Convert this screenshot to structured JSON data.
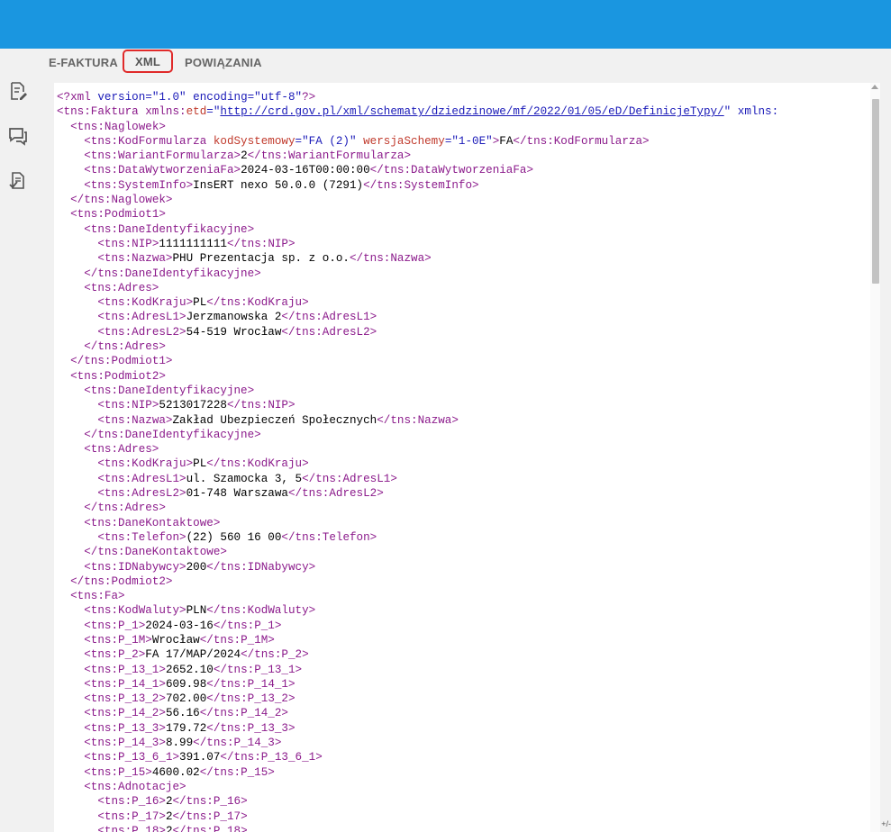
{
  "tabs": [
    {
      "label": "E-FAKTURA",
      "active": false
    },
    {
      "label": "XML",
      "active": true
    },
    {
      "label": "POWIĄZANIA",
      "active": false
    }
  ],
  "sidebar": {
    "icons": [
      "edit-document-icon",
      "chat-icon",
      "document-check-icon"
    ]
  },
  "colors": {
    "header": "#1a96e0",
    "tag": "#8b1a8b",
    "attribute": "#c0392b",
    "value": "#1a1ab8",
    "active_tab_border": "#e02a2a"
  },
  "xml_lines": [
    {
      "indent": 0,
      "parts": [
        {
          "t": "<?xml ",
          "c": "k"
        },
        {
          "t": "version=\"1.0\" encoding=\"utf-8\"",
          "c": "v"
        },
        {
          "t": "?>",
          "c": "k"
        }
      ]
    },
    {
      "indent": 0,
      "parts": [
        {
          "t": "<tns:Faktura xmlns:",
          "c": "k"
        },
        {
          "t": "etd",
          "c": "a"
        },
        {
          "t": "=\"",
          "c": "v"
        },
        {
          "t": "http://crd.gov.pl/xml/schematy/dziedzinowe/mf/2022/01/05/eD/DefinicjeTypy/",
          "c": "u"
        },
        {
          "t": "\" xmlns:",
          "c": "v"
        }
      ]
    },
    {
      "indent": 1,
      "parts": [
        {
          "t": "<tns:Naglowek>",
          "c": "k"
        }
      ]
    },
    {
      "indent": 2,
      "parts": [
        {
          "t": "<tns:KodFormularza ",
          "c": "k"
        },
        {
          "t": "kodSystemowy",
          "c": "a"
        },
        {
          "t": "=\"FA (2)\" ",
          "c": "v"
        },
        {
          "t": "wersjaSchemy",
          "c": "a"
        },
        {
          "t": "=\"1-0E\"",
          "c": "v"
        },
        {
          "t": ">",
          "c": "k"
        },
        {
          "t": "FA",
          "c": ""
        },
        {
          "t": "</tns:KodFormularza>",
          "c": "k"
        }
      ]
    },
    {
      "indent": 2,
      "parts": [
        {
          "t": "<tns:WariantFormularza>",
          "c": "k"
        },
        {
          "t": "2",
          "c": ""
        },
        {
          "t": "</tns:WariantFormularza>",
          "c": "k"
        }
      ]
    },
    {
      "indent": 2,
      "parts": [
        {
          "t": "<tns:DataWytworzeniaFa>",
          "c": "k"
        },
        {
          "t": "2024-03-16T00:00:00",
          "c": ""
        },
        {
          "t": "</tns:DataWytworzeniaFa>",
          "c": "k"
        }
      ]
    },
    {
      "indent": 2,
      "parts": [
        {
          "t": "<tns:SystemInfo>",
          "c": "k"
        },
        {
          "t": "InsERT nexo 50.0.0 (7291)",
          "c": ""
        },
        {
          "t": "</tns:SystemInfo>",
          "c": "k"
        }
      ]
    },
    {
      "indent": 1,
      "parts": [
        {
          "t": "</tns:Naglowek>",
          "c": "k"
        }
      ]
    },
    {
      "indent": 1,
      "parts": [
        {
          "t": "<tns:Podmiot1>",
          "c": "k"
        }
      ]
    },
    {
      "indent": 2,
      "parts": [
        {
          "t": "<tns:DaneIdentyfikacyjne>",
          "c": "k"
        }
      ]
    },
    {
      "indent": 3,
      "parts": [
        {
          "t": "<tns:NIP>",
          "c": "k"
        },
        {
          "t": "1111111111",
          "c": ""
        },
        {
          "t": "</tns:NIP>",
          "c": "k"
        }
      ]
    },
    {
      "indent": 3,
      "parts": [
        {
          "t": "<tns:Nazwa>",
          "c": "k"
        },
        {
          "t": "PHU Prezentacja sp. z o.o.",
          "c": ""
        },
        {
          "t": "</tns:Nazwa>",
          "c": "k"
        }
      ]
    },
    {
      "indent": 2,
      "parts": [
        {
          "t": "</tns:DaneIdentyfikacyjne>",
          "c": "k"
        }
      ]
    },
    {
      "indent": 2,
      "parts": [
        {
          "t": "<tns:Adres>",
          "c": "k"
        }
      ]
    },
    {
      "indent": 3,
      "parts": [
        {
          "t": "<tns:KodKraju>",
          "c": "k"
        },
        {
          "t": "PL",
          "c": ""
        },
        {
          "t": "</tns:KodKraju>",
          "c": "k"
        }
      ]
    },
    {
      "indent": 3,
      "parts": [
        {
          "t": "<tns:AdresL1>",
          "c": "k"
        },
        {
          "t": "Jerzmanowska 2",
          "c": ""
        },
        {
          "t": "</tns:AdresL1>",
          "c": "k"
        }
      ]
    },
    {
      "indent": 3,
      "parts": [
        {
          "t": "<tns:AdresL2>",
          "c": "k"
        },
        {
          "t": "54-519 Wrocław",
          "c": ""
        },
        {
          "t": "</tns:AdresL2>",
          "c": "k"
        }
      ]
    },
    {
      "indent": 2,
      "parts": [
        {
          "t": "</tns:Adres>",
          "c": "k"
        }
      ]
    },
    {
      "indent": 1,
      "parts": [
        {
          "t": "</tns:Podmiot1>",
          "c": "k"
        }
      ]
    },
    {
      "indent": 1,
      "parts": [
        {
          "t": "<tns:Podmiot2>",
          "c": "k"
        }
      ]
    },
    {
      "indent": 2,
      "parts": [
        {
          "t": "<tns:DaneIdentyfikacyjne>",
          "c": "k"
        }
      ]
    },
    {
      "indent": 3,
      "parts": [
        {
          "t": "<tns:NIP>",
          "c": "k"
        },
        {
          "t": "5213017228",
          "c": ""
        },
        {
          "t": "</tns:NIP>",
          "c": "k"
        }
      ]
    },
    {
      "indent": 3,
      "parts": [
        {
          "t": "<tns:Nazwa>",
          "c": "k"
        },
        {
          "t": "Zakład Ubezpieczeń Społecznych",
          "c": ""
        },
        {
          "t": "</tns:Nazwa>",
          "c": "k"
        }
      ]
    },
    {
      "indent": 2,
      "parts": [
        {
          "t": "</tns:DaneIdentyfikacyjne>",
          "c": "k"
        }
      ]
    },
    {
      "indent": 2,
      "parts": [
        {
          "t": "<tns:Adres>",
          "c": "k"
        }
      ]
    },
    {
      "indent": 3,
      "parts": [
        {
          "t": "<tns:KodKraju>",
          "c": "k"
        },
        {
          "t": "PL",
          "c": ""
        },
        {
          "t": "</tns:KodKraju>",
          "c": "k"
        }
      ]
    },
    {
      "indent": 3,
      "parts": [
        {
          "t": "<tns:AdresL1>",
          "c": "k"
        },
        {
          "t": "ul. Szamocka 3, 5",
          "c": ""
        },
        {
          "t": "</tns:AdresL1>",
          "c": "k"
        }
      ]
    },
    {
      "indent": 3,
      "parts": [
        {
          "t": "<tns:AdresL2>",
          "c": "k"
        },
        {
          "t": "01-748 Warszawa",
          "c": ""
        },
        {
          "t": "</tns:AdresL2>",
          "c": "k"
        }
      ]
    },
    {
      "indent": 2,
      "parts": [
        {
          "t": "</tns:Adres>",
          "c": "k"
        }
      ]
    },
    {
      "indent": 2,
      "parts": [
        {
          "t": "<tns:DaneKontaktowe>",
          "c": "k"
        }
      ]
    },
    {
      "indent": 3,
      "parts": [
        {
          "t": "<tns:Telefon>",
          "c": "k"
        },
        {
          "t": "(22) 560 16 00",
          "c": ""
        },
        {
          "t": "</tns:Telefon>",
          "c": "k"
        }
      ]
    },
    {
      "indent": 2,
      "parts": [
        {
          "t": "</tns:DaneKontaktowe>",
          "c": "k"
        }
      ]
    },
    {
      "indent": 2,
      "parts": [
        {
          "t": "<tns:IDNabywcy>",
          "c": "k"
        },
        {
          "t": "200",
          "c": ""
        },
        {
          "t": "</tns:IDNabywcy>",
          "c": "k"
        }
      ]
    },
    {
      "indent": 1,
      "parts": [
        {
          "t": "</tns:Podmiot2>",
          "c": "k"
        }
      ]
    },
    {
      "indent": 1,
      "parts": [
        {
          "t": "<tns:Fa>",
          "c": "k"
        }
      ]
    },
    {
      "indent": 2,
      "parts": [
        {
          "t": "<tns:KodWaluty>",
          "c": "k"
        },
        {
          "t": "PLN",
          "c": ""
        },
        {
          "t": "</tns:KodWaluty>",
          "c": "k"
        }
      ]
    },
    {
      "indent": 2,
      "parts": [
        {
          "t": "<tns:P_1>",
          "c": "k"
        },
        {
          "t": "2024-03-16",
          "c": ""
        },
        {
          "t": "</tns:P_1>",
          "c": "k"
        }
      ]
    },
    {
      "indent": 2,
      "parts": [
        {
          "t": "<tns:P_1M>",
          "c": "k"
        },
        {
          "t": "Wrocław",
          "c": ""
        },
        {
          "t": "</tns:P_1M>",
          "c": "k"
        }
      ]
    },
    {
      "indent": 2,
      "parts": [
        {
          "t": "<tns:P_2>",
          "c": "k"
        },
        {
          "t": "FA 17/MAP/2024",
          "c": ""
        },
        {
          "t": "</tns:P_2>",
          "c": "k"
        }
      ]
    },
    {
      "indent": 2,
      "parts": [
        {
          "t": "<tns:P_13_1>",
          "c": "k"
        },
        {
          "t": "2652.10",
          "c": ""
        },
        {
          "t": "</tns:P_13_1>",
          "c": "k"
        }
      ]
    },
    {
      "indent": 2,
      "parts": [
        {
          "t": "<tns:P_14_1>",
          "c": "k"
        },
        {
          "t": "609.98",
          "c": ""
        },
        {
          "t": "</tns:P_14_1>",
          "c": "k"
        }
      ]
    },
    {
      "indent": 2,
      "parts": [
        {
          "t": "<tns:P_13_2>",
          "c": "k"
        },
        {
          "t": "702.00",
          "c": ""
        },
        {
          "t": "</tns:P_13_2>",
          "c": "k"
        }
      ]
    },
    {
      "indent": 2,
      "parts": [
        {
          "t": "<tns:P_14_2>",
          "c": "k"
        },
        {
          "t": "56.16",
          "c": ""
        },
        {
          "t": "</tns:P_14_2>",
          "c": "k"
        }
      ]
    },
    {
      "indent": 2,
      "parts": [
        {
          "t": "<tns:P_13_3>",
          "c": "k"
        },
        {
          "t": "179.72",
          "c": ""
        },
        {
          "t": "</tns:P_13_3>",
          "c": "k"
        }
      ]
    },
    {
      "indent": 2,
      "parts": [
        {
          "t": "<tns:P_14_3>",
          "c": "k"
        },
        {
          "t": "8.99",
          "c": ""
        },
        {
          "t": "</tns:P_14_3>",
          "c": "k"
        }
      ]
    },
    {
      "indent": 2,
      "parts": [
        {
          "t": "<tns:P_13_6_1>",
          "c": "k"
        },
        {
          "t": "391.07",
          "c": ""
        },
        {
          "t": "</tns:P_13_6_1>",
          "c": "k"
        }
      ]
    },
    {
      "indent": 2,
      "parts": [
        {
          "t": "<tns:P_15>",
          "c": "k"
        },
        {
          "t": "4600.02",
          "c": ""
        },
        {
          "t": "</tns:P_15>",
          "c": "k"
        }
      ]
    },
    {
      "indent": 2,
      "parts": [
        {
          "t": "<tns:Adnotacje>",
          "c": "k"
        }
      ]
    },
    {
      "indent": 3,
      "parts": [
        {
          "t": "<tns:P_16>",
          "c": "k"
        },
        {
          "t": "2",
          "c": ""
        },
        {
          "t": "</tns:P_16>",
          "c": "k"
        }
      ]
    },
    {
      "indent": 3,
      "parts": [
        {
          "t": "<tns:P_17>",
          "c": "k"
        },
        {
          "t": "2",
          "c": ""
        },
        {
          "t": "</tns:P_17>",
          "c": "k"
        }
      ]
    },
    {
      "indent": 3,
      "parts": [
        {
          "t": "<tns:P_18>",
          "c": "k"
        },
        {
          "t": "2",
          "c": ""
        },
        {
          "t": "</tns:P_18>",
          "c": "k"
        }
      ]
    }
  ],
  "corner_text": "+/-"
}
